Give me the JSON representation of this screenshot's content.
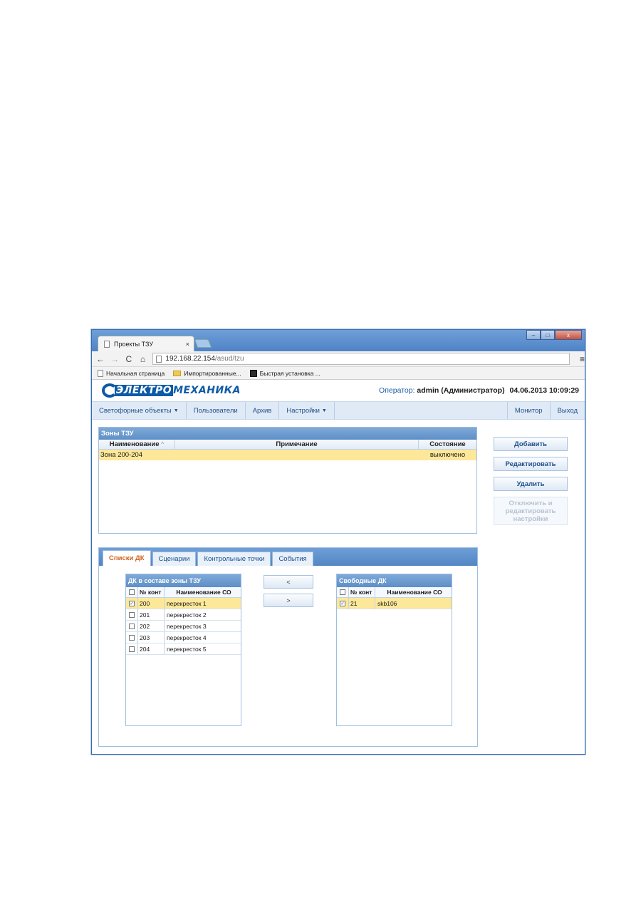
{
  "browser": {
    "tab_title": "Проекты ТЗУ",
    "tab_close": "×",
    "window_buttons": [
      "–",
      "□",
      "x"
    ],
    "nav": {
      "back": "←",
      "forward": "→",
      "reload": "C",
      "home": "⌂"
    },
    "url_host": "192.168.22.154",
    "url_path": "/asud/tzu",
    "menu": "≡",
    "bookmarks": [
      {
        "label": "Начальная страница",
        "icon": "page-icon"
      },
      {
        "label": "Импортированные...",
        "icon": "folder-icon"
      },
      {
        "label": "Быстрая установка ...",
        "icon": "app-icon"
      }
    ]
  },
  "header": {
    "logo_part1": "ЭЛЕКТРО",
    "logo_part2": "МЕХАНИКА",
    "operator_label": "Оператор:",
    "operator_name": "admin (Администратор)",
    "datetime": "04.06.2013 10:09:29"
  },
  "nav": {
    "items": [
      "Светофорные объекты",
      "Пользователи",
      "Архив",
      "Настройки"
    ],
    "right": [
      "Монитор",
      "Выход"
    ]
  },
  "zones": {
    "title": "Зоны ТЗУ",
    "columns": [
      "Наименование",
      "Примечание",
      "Состояние"
    ],
    "sort_marker": "^",
    "rows": [
      {
        "name": "Зона 200-204",
        "note": "",
        "state": "выключено"
      }
    ]
  },
  "actions": {
    "add": "Добавить",
    "edit": "Редактировать",
    "delete": "Удалить",
    "disable_edit": "Отключить и редактировать настройки"
  },
  "tabs": [
    "Списки ДК",
    "Сценарии",
    "Контрольные точки",
    "События"
  ],
  "zone_dk": {
    "title": "ДК в составе зоны ТЗУ",
    "columns": [
      "№ конт",
      "Наименование СО"
    ],
    "rows": [
      {
        "num": "200",
        "name": "перекресток 1",
        "checked": true
      },
      {
        "num": "201",
        "name": "перекресток 2",
        "checked": false
      },
      {
        "num": "202",
        "name": "перекресток 3",
        "checked": false
      },
      {
        "num": "203",
        "name": "перекресток 4",
        "checked": false
      },
      {
        "num": "204",
        "name": "перекресток 5",
        "checked": false
      }
    ]
  },
  "move": {
    "left": "<",
    "right": ">"
  },
  "free_dk": {
    "title": "Свободные ДК",
    "columns": [
      "№ конт",
      "Наименование СО"
    ],
    "rows": [
      {
        "num": "21",
        "name": "skb106",
        "checked": true
      }
    ]
  },
  "checkmark": "✓"
}
